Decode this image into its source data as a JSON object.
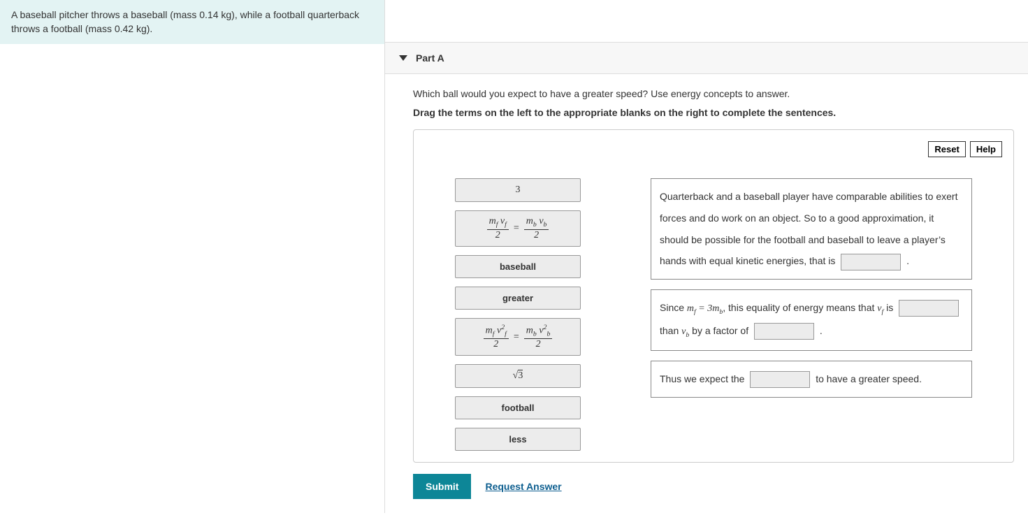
{
  "problem": "A baseball pitcher throws a baseball (mass 0.14 kg), while a football quarterback throws a football (mass 0.42 kg).",
  "part": {
    "label": "Part A"
  },
  "question": "Which ball would you expect to have a greater speed? Use energy concepts to answer.",
  "instruction": "Drag the terms on the left to the appropriate blanks on the right to complete the sentences.",
  "buttons": {
    "reset": "Reset",
    "help": "Help",
    "submit": "Submit",
    "request_answer": "Request Answer"
  },
  "terms": [
    {
      "id": "three",
      "type": "math",
      "display": "3"
    },
    {
      "id": "eq_momentum",
      "type": "math"
    },
    {
      "id": "baseball",
      "type": "text",
      "display": "baseball"
    },
    {
      "id": "greater",
      "type": "text",
      "display": "greater"
    },
    {
      "id": "eq_ke",
      "type": "math"
    },
    {
      "id": "sqrt3",
      "type": "math"
    },
    {
      "id": "football",
      "type": "text",
      "display": "football"
    },
    {
      "id": "less",
      "type": "text",
      "display": "less"
    }
  ],
  "targets": {
    "sentence1": {
      "t1": "Quarterback and a baseball player have comparable abilities to exert forces and do work on an object. So to a good approximation, it should be possible for the football and baseball to leave a player’s hands with equal kinetic energies, that is",
      "t2": "."
    },
    "sentence2": {
      "t1": "Since ",
      "eq": "m_f = 3m_b",
      "t2": ", this equality of energy means that ",
      "vf": "v_f",
      "t3": " is",
      "t4": "than ",
      "vb": "v_b",
      "t5": " by a factor of",
      "t6": "."
    },
    "sentence3": {
      "t1": "Thus we expect the",
      "t2": "to have a greater speed."
    }
  }
}
